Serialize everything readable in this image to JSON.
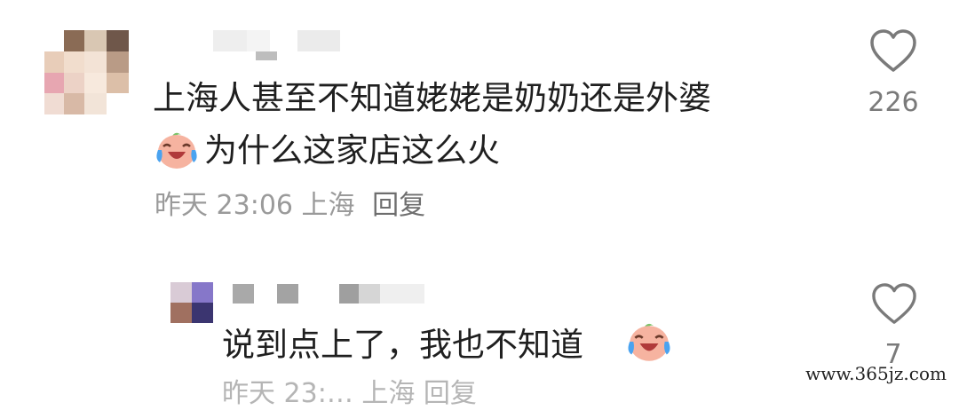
{
  "comments": [
    {
      "text_line1": "上海人甚至不知道姥姥是奶奶还是外婆",
      "text_line2": "为什么这家店这么火",
      "emoji": "crying-laughing-face",
      "time": "昨天 23:06",
      "location": "上海",
      "reply_label": "回复",
      "likes": "226"
    },
    {
      "text_line1": "说到点上了，我也不知道",
      "emoji": "crying-laughing-face",
      "likes": "7",
      "partial_meta": "昨天 23:… 上海 回复"
    }
  ],
  "watermark": "www.365jz.com",
  "colors": {
    "text": "#1f1f1f",
    "meta": "#9a9a9a",
    "icon_stroke": "#7a7a7a"
  }
}
